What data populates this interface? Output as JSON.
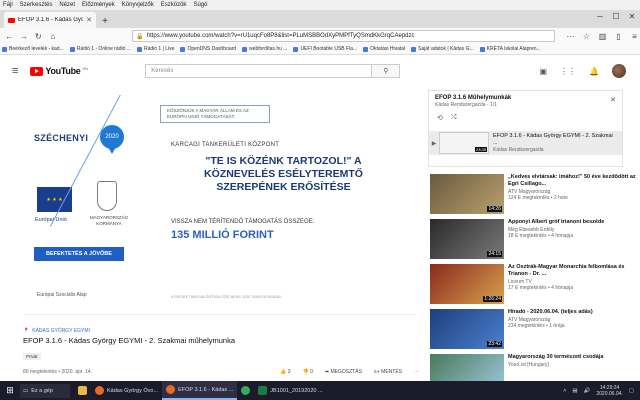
{
  "menubar": {
    "items": [
      "Fájl",
      "Szerkesztés",
      "Nézet",
      "Előzmények",
      "Könyvjelzők",
      "Eszközök",
      "Súgó"
    ]
  },
  "tab": {
    "title": "EFOP 3.1.6 - Kádas György E..."
  },
  "url": {
    "value": "https://www.youtube.com/watch?v=rU1uqcFo8P8&list=PLuMSBBOdXyPMPfTyQSmdKkGrqCAepdzc"
  },
  "bookmarks": [
    "Beérkező levelek - kad...",
    "Rádió 1 - Online rádió ...",
    "Rádió 1 | Live",
    "OpenDNS Dashboard",
    "webfordítas.hu ...",
    "UEFI Bootable USB Fla...",
    "Oktatási Hivatal",
    "Saját adatok | Kádas G...",
    "KRÉTA Iskolai Alapren..."
  ],
  "yt": {
    "logo": "YouTube",
    "region": "HU",
    "search_placeholder": "Keresés"
  },
  "video": {
    "brand": "SZÉCHENYI",
    "brand_year": "2020",
    "eu_label": "Európai Unió",
    "gov_label": "MAGYARORSZÁG KORMÁNYA",
    "invest": "BEFEKTETÉS A JÖVŐBE",
    "esa": "Európai Szociális Alap",
    "notice": "KÖSZÖNJÜK A MAGYAR ÁLLAM ÉS AZ EURÓPAI UNIÓ TÁMOGATÁSÁT.",
    "center": "KARCAGI TANKERÜLETI KÖZPONT",
    "headline": "\"TE IS KÖZÉNK TARTOZOL!\" A KÖZNEVELÉS ESÉLYTEREMTŐ SZEREPÉNEK ERŐSÍTÉSE",
    "support": "VISSZA NEM TÉRÍTENDŐ TÁMOGATÁS ÖSSZEGE:",
    "amount": "135 MILLIÓ FORINT",
    "fine": "A PROJEKT MEGVALÓSÍTÁSA SZÉCHENYI 2020 TÁMOGATÁSÁVAL"
  },
  "info": {
    "channel": "KÁDAS GYÖRGY EGYMI",
    "title": "EFOP 3.1.6 - Kádas György EGYMI - 2. Szakmai műhelymunka",
    "privacy": "Privát",
    "meta": "80 megtekintés • 2020. ápr. 14.",
    "likes": "3",
    "dislikes": "0",
    "share": "MEGOSZTÁS",
    "save": "MENTÉS"
  },
  "playlist": {
    "title": "EFOP 3.1.6 Műhelymunkák",
    "sub": "Kádas Rendszergazda - 1/1",
    "item_title": "EFOP 3.1.6 - Kádas György EGYMI - 2. Szakmai ...",
    "item_channel": "Kádas Rendszergazda",
    "item_duration": "23:35"
  },
  "recommendations": [
    {
      "title": "„Kedves elvtársak: imához!\" 50 éve kezdődött az Egri Csillago...",
      "channel": "ATV Magyarország",
      "meta": "124 E megtekintés • 2 hete",
      "duration": "14:26",
      "color": "#6b5a3c"
    },
    {
      "title": "Apponyi Albert gróf trianoni beszéde",
      "channel": "Még Ébesebb Erdély",
      "meta": "18 E megtekintés • 4 hónapja",
      "duration": "24:15",
      "color": "#3a3a3a"
    },
    {
      "title": "Az Osztrák-Magyar Monarchia felbomlása és Trianon - Dr. ...",
      "channel": "Liceum TV",
      "meta": "17 E megtekintés • 4 hónapja",
      "duration": "1:26:24",
      "color": "#8a2a1c"
    },
    {
      "title": "Híradó - 2020.06.04. (teljes adás)",
      "channel": "ATV Magyarország",
      "meta": "234 megtekintés • 1 órája",
      "duration": "23:42",
      "color": "#1d3f7a"
    },
    {
      "title": "Magyarország 30 természeti csodája",
      "channel": "YourList [Hungary]",
      "meta": "",
      "duration": "",
      "color": "#4a7a5a"
    }
  ],
  "taskbar": {
    "search": "Ez a gép",
    "items": [
      "Kádas György Óvo...",
      "EFOP 3.1.6 - Kádas ...",
      "JB1001_20192020 ..."
    ],
    "time": "14:29:24",
    "date": "2020.06.04."
  }
}
